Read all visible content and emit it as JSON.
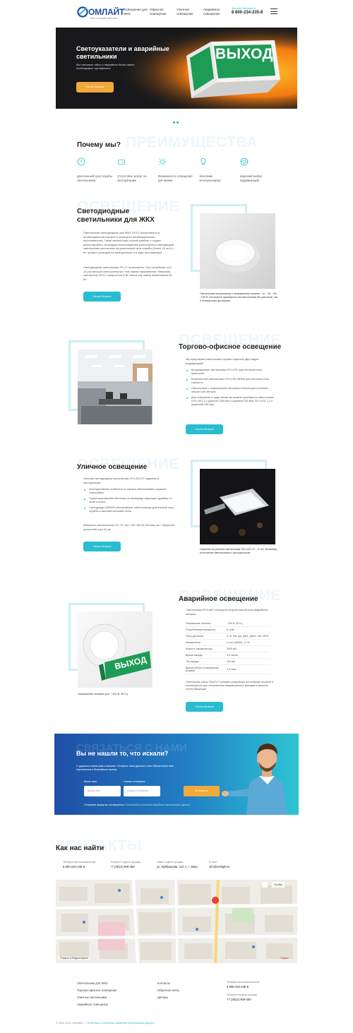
{
  "header": {
    "brand": "ОМЛАЙТ",
    "tagline": "Свет, который работает",
    "nav": [
      "Освещение для ЖКХ",
      "Офисное освещение",
      "Уличное освещение",
      "Аварийное освещение"
    ],
    "phone_title": "Звоните бесплатно",
    "phone": "8 800-234-235-8"
  },
  "hero": {
    "title": "Светоуказатели и аварийные светильники",
    "text": "Все световые табло и аварийные блоки имеют необходимые сертификаты",
    "button": "Узнать больше",
    "sign_text": "ВЫХОД"
  },
  "advantages": {
    "watermark": "ПРЕИМУЩЕСТВА",
    "title": "Почему мы?",
    "items": [
      {
        "label": "Длительный срок службы светильников",
        "icon": "clock-icon"
      },
      {
        "label": "Отсутствие затрат на эксплуатацию",
        "icon": "wallet-icon"
      },
      {
        "label": "Возможность освещения датчиками",
        "icon": "sun-icon"
      },
      {
        "label": "Экономия электроэнергии",
        "icon": "bulb-icon"
      },
      {
        "label": "Широкий выбор модификаций",
        "icon": "aperture-icon"
      }
    ]
  },
  "zhkh": {
    "watermark": "ОСВЕЩЕНИЕ",
    "title": "Светодиодные светильники для ЖКХ",
    "p1": "Светильники светодиодные для ЖКХ ЛУЧ-С выпускаются в антивандальном корпусе и оснащены антивандальным рассеивателем. Такие светильники сложно разбить и трудно демонтировать. Благодаря использованию качественных светодиодов светильники рассчитаны на длительный срок службы (более 10 лет) и не требуют расходов на эксплуатацию и в ходе эксплуатации.",
    "p2": "Светодиодные светильники ЛУЧ-С экономичны. Они потребляют в 6-10 раз меньше электроэнергии, чем лампы накаливания. Например, светильник ЛУЧ-С мощностью 6 Вт светит как лампа накаливания 60 Вт.",
    "button": "Узнать больше",
    "caption": "Светильники выпускаются с напряжением питания ~12, ~24, ~36, ~220 В. Вы можете приобрести как светильники без датчиков, так и оснащенные датчиками."
  },
  "office": {
    "watermark": "ОСВЕЩЕНИЕ",
    "title": "Торгово-офисное освещение",
    "intro": "Мы предлагаем светильники торгово-офисные двух видов модификаций:",
    "items": [
      "Встраиваемые светильники ЛУЧ-LED для потолков типа Армстронг.",
      "Комплектные светильники ЛУЧ-LED МИНИ для потолков типа Грильято.",
      "Светильники с повышенным световым потоком для потолков свыше трех метров.",
      "Для освещения в одну линию вы можете приобрести светильники ЛУЧ-LED 1,2 (длиной 1200 мм и шириной 200 мм) ЛУЧ-LED 1,2-2 (шириной 180 мм)."
    ],
    "button": "Узнать больше"
  },
  "street": {
    "watermark": "ОСВЕЩЕНИЕ",
    "title": "Уличное освещение",
    "intro": "Уличные светодиодные светильники ЛУЧ-220-СТ надежны в эксплуатации.",
    "items": [
      "Конструктивные особенности корпуса обеспечивают хороший теплообмен.",
      "Герметизированная оболочка из компаунда защищает драйвер от пыли и влаги.",
      "Светодиоды OSRAM обеспечивают светильникам длительный срок службы и высокий световой поток."
    ],
    "power": "Мощность светильников: 50, 70, 120, 150, 180 Вт. Монтаж на Г-образный кронштейн в до 56 см.",
    "button": "Узнать больше",
    "caption": "Гарантия на уличные светильники ЛУЧ-220-СТ – 5 лет. Возможно исполнение светильников с фотодатчиком."
  },
  "emergency": {
    "watermark": "ОСВЕЩЕНИЕ",
    "title": "Аварийное освещение",
    "intro": "Светильники ЛУЧ-БАП оснащены встроенным блоком аварийного питания.",
    "specs": [
      {
        "k": "Напряжение питания",
        "v": "~220 В, 50 Гц"
      },
      {
        "k": "Потребляемая мощность",
        "v": "6, 8 Вт"
      },
      {
        "k": "Типы датчиков",
        "v": "А, Ф, ФА, ДА, ДФА, ДФА1, МЕ, МЕФ"
      },
      {
        "k": "Аккумулятор",
        "v": "Li-Ion (18650), 3,7 В"
      },
      {
        "k": "Емкость аккумулятора",
        "v": "2600 мА"
      },
      {
        "k": "Время заряда",
        "v": "4,5 часов"
      },
      {
        "k": "Ток заряда",
        "v": "400 мА"
      },
      {
        "k": "Время работы в аварийном режиме",
        "v": "2,5 часа"
      }
    ],
    "note": "Светильник табло ЛБАП-Р оснащен резервным источником питания и используется для обозначения эвакуационных выходов в регионе путей эвакуации.",
    "button": "Узнать больше",
    "caption": "Напряжение питания для: ~220 В, 50 Гц",
    "sign_text": "ВЫХОД"
  },
  "cta": {
    "watermark": "СВЯЗАТЬСЯ С НАМИ",
    "title": "Вы не нашли то, что искали?",
    "text": "С удовольствием вам поможем. Оставьте свои данные и мы обязательно вам перезвоним в ближайшее время.",
    "name_label": "Ваше имя",
    "name_placeholder": "Ваше имя",
    "phone_label": "Номер телефона",
    "phone_placeholder": "Номер телефона",
    "button": "Отправить",
    "legal_prefix": "Отправляя форму вы соглашаетесь:",
    "legal_link": "Политикой в отношении обработки персональных данных"
  },
  "contacts": {
    "watermark": "КОНТАКТЫ",
    "title": "Как нас найти",
    "items": [
      {
        "t": "Телефон многоканальный",
        "v": "8 800-234-235-8"
      },
      {
        "t": "Телефон отдела продаж",
        "v": "+7 (3812) 909-450"
      },
      {
        "t": "Офис отдела продаж",
        "v": "ул. Куйбышева, 113 А, г. Омск"
      },
      {
        "t": "E-mail",
        "v": "info@omlight.ru"
      }
    ]
  },
  "map": {
    "traffic": "Пробки",
    "corner_left": "Открыть в Яндекс.Картах",
    "corner_right": "Яндекс"
  },
  "footer": {
    "col1": [
      "Светильники для ЖКХ",
      "Торгово-офисное освещение",
      "Уличные светильники",
      "Аварийное освещение"
    ],
    "col2": [
      "Контакты",
      "Обратная связь",
      "Дилеры"
    ],
    "phone1_t": "Телефон многоканальный",
    "phone1": "8 800-234-235-8",
    "phone2_t": "Телефон отдела продаж",
    "phone2": "+7 (3812) 909-450",
    "copyright": "© 2015–2021 «Омлайт»",
    "policy": "Политика в отношении обработки персональных данных"
  }
}
